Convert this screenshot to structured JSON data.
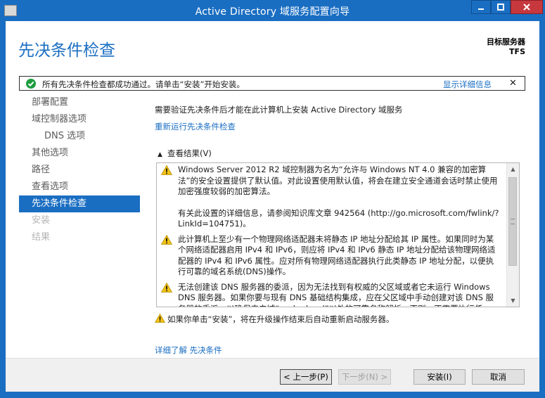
{
  "window": {
    "title": "Active Directory 域服务配置向导"
  },
  "header": {
    "page_title": "先决条件检查",
    "target_label": "目标服务器",
    "target_value": "TFS"
  },
  "status_bar": {
    "message": "所有先决条件检查都成功通过。请单击“安装”开始安装。",
    "details_link": "显示详细信息",
    "close": "✕"
  },
  "nav": {
    "items": [
      {
        "label": "部署配置",
        "state": "normal"
      },
      {
        "label": "域控制器选项",
        "state": "normal"
      },
      {
        "label": "DNS 选项",
        "state": "sub"
      },
      {
        "label": "其他选项",
        "state": "normal"
      },
      {
        "label": "路径",
        "state": "normal"
      },
      {
        "label": "查看选项",
        "state": "normal"
      },
      {
        "label": "先决条件检查",
        "state": "active"
      },
      {
        "label": "安装",
        "state": "disabled"
      },
      {
        "label": "结果",
        "state": "disabled"
      }
    ]
  },
  "content": {
    "lead": "需要验证先决条件后才能在此计算机上安装 Active Directory 域服务",
    "rerun_link": "重新运行先决条件检查",
    "results_header": "查看结果(V)",
    "results": [
      {
        "text": "Windows Server 2012 R2 域控制器为名为“允许与 Windows NT 4.0 兼容的加密算法”的安全设置提供了默认值。对此设置使用默认值，将会在建立安全通道会话时禁止使用加密强度较弱的加密算法。",
        "text2": "有关此设置的详细信息，请参阅知识库文章 942564 (http://go.microsoft.com/fwlink/?LinkId=104751)。"
      },
      {
        "text": "此计算机上至少有一个物理网络适配器未将静态 IP 地址分配给其 IP 属性。如果同时为某个网络适配器启用 IPv4 和 IPv6，则应将 IPv4 和 IPv6 静态 IP 地址分配给该物理网络适配器的 IPv4 和 IPv6 属性。应对所有物理网络适配器执行此类静态 IP 地址分配，以便执行可靠的域名系统(DNS)操作。",
        "text2": ""
      },
      {
        "text": "无法创建该 DNS 服务器的委派，因为无法找到有权威的父区域或者它未运行 Windows DNS 服务器。如果你要与现有 DNS 基础结构集成，应在父区域中手动创建对该 DNS 服务器的委派，以确保来自域“vsalm.local”以外的可靠名称解析。否则，不需要执行任",
        "text2": ""
      }
    ],
    "footer_warning": "如果你单击“安装”，将在升级操作结束后自动重新启动服务器。",
    "more_link": "详细了解 先决条件"
  },
  "buttons": {
    "prev": "< 上一步(P)",
    "next": "下一步(N) >",
    "install": "安装(I)",
    "cancel": "取消"
  }
}
